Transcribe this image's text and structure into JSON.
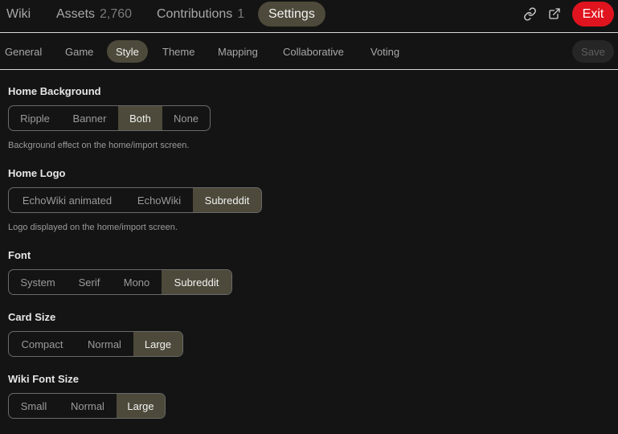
{
  "topnav": {
    "wiki": "Wiki",
    "assets": "Assets",
    "assets_count": "2,760",
    "contributions": "Contributions",
    "contributions_count": "1",
    "settings": "Settings",
    "exit": "Exit",
    "icons": [
      "link-icon",
      "external-link-icon"
    ]
  },
  "subnav": {
    "tabs": [
      "General",
      "Game",
      "Style",
      "Theme",
      "Mapping",
      "Collaborative",
      "Voting"
    ],
    "active": "Style",
    "save": "Save"
  },
  "settings": {
    "home_background": {
      "label": "Home Background",
      "options": [
        "Ripple",
        "Banner",
        "Both",
        "None"
      ],
      "selected": "Both",
      "help": "Background effect on the home/import screen."
    },
    "home_logo": {
      "label": "Home Logo",
      "options": [
        "EchoWiki animated",
        "EchoWiki",
        "Subreddit"
      ],
      "selected": "Subreddit",
      "help": "Logo displayed on the home/import screen."
    },
    "font": {
      "label": "Font",
      "options": [
        "System",
        "Serif",
        "Mono",
        "Subreddit"
      ],
      "selected": "Subreddit"
    },
    "card_size": {
      "label": "Card Size",
      "options": [
        "Compact",
        "Normal",
        "Large"
      ],
      "selected": "Large"
    },
    "wiki_font_size": {
      "label": "Wiki Font Size",
      "options": [
        "Small",
        "Normal",
        "Large"
      ],
      "selected": "Large"
    }
  },
  "colors": {
    "background": "#141414",
    "active_pill": "#4d4a3b",
    "exit_red": "#e0141e",
    "divider": "#d8d8d8"
  }
}
